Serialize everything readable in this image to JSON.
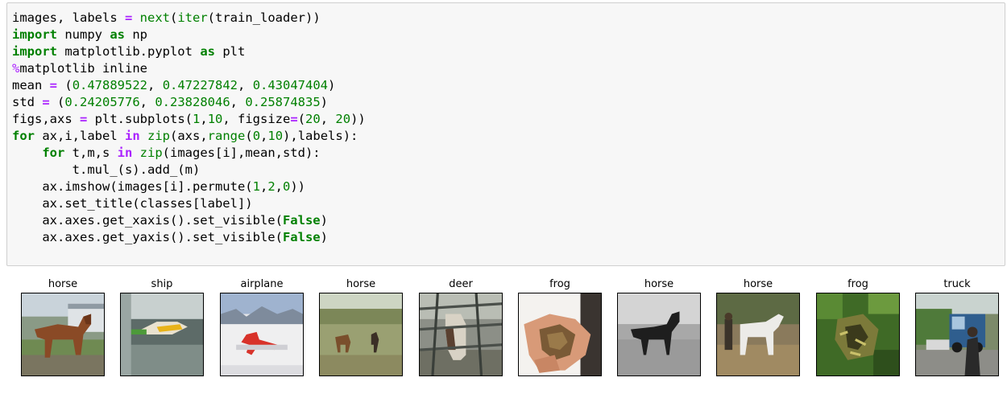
{
  "code_cell": {
    "lines": [
      [
        {
          "t": "images, labels "
        },
        {
          "t": "=",
          "c": "op"
        },
        {
          "t": " "
        },
        {
          "t": "next",
          "c": "bi"
        },
        {
          "t": "("
        },
        {
          "t": "iter",
          "c": "bi"
        },
        {
          "t": "(train_loader))"
        }
      ],
      [
        {
          "t": "import",
          "c": "kw"
        },
        {
          "t": " numpy "
        },
        {
          "t": "as",
          "c": "kw"
        },
        {
          "t": " np"
        }
      ],
      [
        {
          "t": "import",
          "c": "kw"
        },
        {
          "t": " matplotlib.pyplot "
        },
        {
          "t": "as",
          "c": "kw"
        },
        {
          "t": " plt"
        }
      ],
      [
        {
          "t": "%",
          "c": "mg"
        },
        {
          "t": "matplotlib inline"
        }
      ],
      [
        {
          "t": "mean "
        },
        {
          "t": "=",
          "c": "op"
        },
        {
          "t": " ("
        },
        {
          "t": "0.47889522",
          "c": "num"
        },
        {
          "t": ", "
        },
        {
          "t": "0.47227842",
          "c": "num"
        },
        {
          "t": ", "
        },
        {
          "t": "0.43047404",
          "c": "num"
        },
        {
          "t": ")"
        }
      ],
      [
        {
          "t": "std "
        },
        {
          "t": "=",
          "c": "op"
        },
        {
          "t": " ("
        },
        {
          "t": "0.24205776",
          "c": "num"
        },
        {
          "t": ", "
        },
        {
          "t": "0.23828046",
          "c": "num"
        },
        {
          "t": ", "
        },
        {
          "t": "0.25874835",
          "c": "num"
        },
        {
          "t": ")"
        }
      ],
      [
        {
          "t": "figs,axs "
        },
        {
          "t": "=",
          "c": "op"
        },
        {
          "t": " plt.subplots("
        },
        {
          "t": "1",
          "c": "num"
        },
        {
          "t": ","
        },
        {
          "t": "10",
          "c": "num"
        },
        {
          "t": ", figsize"
        },
        {
          "t": "=",
          "c": "op"
        },
        {
          "t": "("
        },
        {
          "t": "20",
          "c": "num"
        },
        {
          "t": ", "
        },
        {
          "t": "20",
          "c": "num"
        },
        {
          "t": "))"
        }
      ],
      [
        {
          "t": "for",
          "c": "kw"
        },
        {
          "t": " ax,i,label "
        },
        {
          "t": "in",
          "c": "op"
        },
        {
          "t": " "
        },
        {
          "t": "zip",
          "c": "bi"
        },
        {
          "t": "(axs,"
        },
        {
          "t": "range",
          "c": "bi"
        },
        {
          "t": "("
        },
        {
          "t": "0",
          "c": "num"
        },
        {
          "t": ","
        },
        {
          "t": "10",
          "c": "num"
        },
        {
          "t": "),labels):"
        }
      ],
      [
        {
          "t": "    "
        },
        {
          "t": "for",
          "c": "kw"
        },
        {
          "t": " t,m,s "
        },
        {
          "t": "in",
          "c": "op"
        },
        {
          "t": " "
        },
        {
          "t": "zip",
          "c": "bi"
        },
        {
          "t": "(images[i],mean,std):"
        }
      ],
      [
        {
          "t": "        t.mul_(s).add_(m)"
        }
      ],
      [
        {
          "t": "    ax.imshow(images[i].permute("
        },
        {
          "t": "1",
          "c": "num"
        },
        {
          "t": ","
        },
        {
          "t": "2",
          "c": "num"
        },
        {
          "t": ","
        },
        {
          "t": "0",
          "c": "num"
        },
        {
          "t": "))"
        }
      ],
      [
        {
          "t": "    ax.set_title(classes[label])"
        }
      ],
      [
        {
          "t": "    ax.axes.get_xaxis().set_visible("
        },
        {
          "t": "False",
          "c": "kw"
        },
        {
          "t": ")"
        }
      ],
      [
        {
          "t": "    ax.axes.get_yaxis().set_visible("
        },
        {
          "t": "False",
          "c": "kw"
        },
        {
          "t": ")"
        }
      ]
    ]
  },
  "output": {
    "subplots": [
      {
        "title": "horse",
        "image": "horse-by-trailer"
      },
      {
        "title": "ship",
        "image": "boat-on-water"
      },
      {
        "title": "airplane",
        "image": "red-white-plane-on-snow"
      },
      {
        "title": "horse",
        "image": "horses-in-field"
      },
      {
        "title": "deer",
        "image": "animal-behind-fence"
      },
      {
        "title": "frog",
        "image": "frog-in-hand"
      },
      {
        "title": "horse",
        "image": "grayscale-horse"
      },
      {
        "title": "horse",
        "image": "white-horse-with-person"
      },
      {
        "title": "frog",
        "image": "green-frog-on-leaves"
      },
      {
        "title": "truck",
        "image": "truck-on-street"
      }
    ]
  }
}
